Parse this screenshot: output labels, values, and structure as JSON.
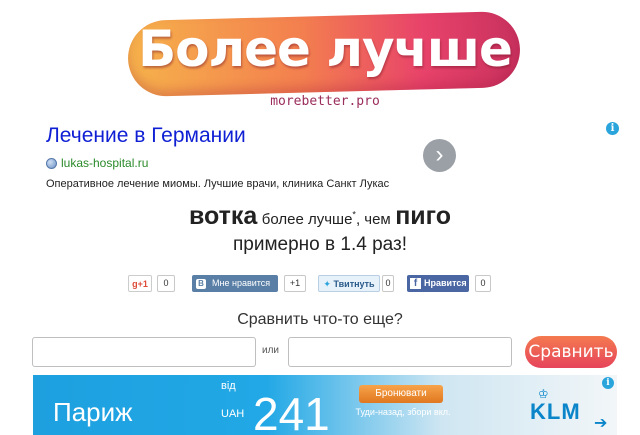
{
  "logo": {
    "title": "Более лучше",
    "site": "morebetter.pro"
  },
  "ad": {
    "title": "Лечение в Германии",
    "domain": "lukas-hospital.ru",
    "description": "Оперативное лечение миомы. Лучшие врачи, клиника Санкт Лукас",
    "next_icon": "›",
    "info_icon": "i"
  },
  "result": {
    "item1": "вотка",
    "connector": "более лучше",
    "superscript": "*",
    "than": ", чем",
    "item2": "пиго",
    "line2": "примерно в 1.4 раз!"
  },
  "social": {
    "gplus_label": "g+1",
    "gplus_count": "0",
    "vk_logo": "В",
    "vk_label": "Мне нравится",
    "vk_count": "+1",
    "twitter_label": "Твитнуть",
    "twitter_count": "0",
    "fb_logo": "f",
    "fb_label": "Нравится",
    "fb_count": "0"
  },
  "compare": {
    "title": "Сравнить что-то еще?",
    "field1_value": "",
    "field2_value": "",
    "or_label": "или",
    "button_label": "Сравнить"
  },
  "banner": {
    "city": "Париж",
    "from": "від",
    "currency": "UAH",
    "price": "241",
    "book_label": "Бронювати",
    "roundtrip": "Туди-назад, збори вкл.",
    "brand": "KLM",
    "info_icon": "i"
  },
  "colors": {
    "ad_link": "#0f1fd4",
    "ad_domain": "#2a8a2a",
    "accent_gradient_start": "#f47a4f",
    "accent_gradient_end": "#e6445b",
    "banner_blue": "#1ea0df"
  }
}
